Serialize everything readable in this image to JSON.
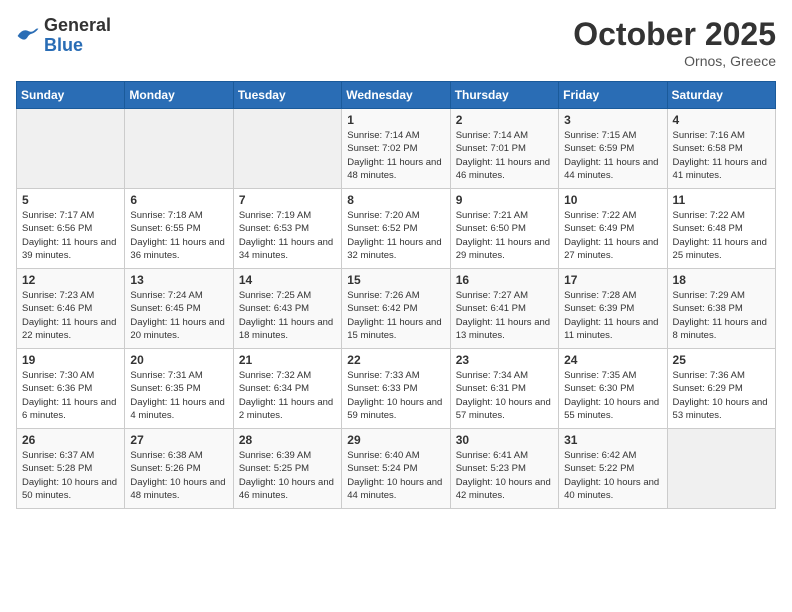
{
  "header": {
    "logo_general": "General",
    "logo_blue": "Blue",
    "month_title": "October 2025",
    "subtitle": "Ornos, Greece"
  },
  "days_of_week": [
    "Sunday",
    "Monday",
    "Tuesday",
    "Wednesday",
    "Thursday",
    "Friday",
    "Saturday"
  ],
  "weeks": [
    {
      "days": [
        {
          "number": "",
          "empty": true
        },
        {
          "number": "",
          "empty": true
        },
        {
          "number": "",
          "empty": true
        },
        {
          "number": "1",
          "sunrise": "7:14 AM",
          "sunset": "7:02 PM",
          "daylight": "11 hours and 48 minutes."
        },
        {
          "number": "2",
          "sunrise": "7:14 AM",
          "sunset": "7:01 PM",
          "daylight": "11 hours and 46 minutes."
        },
        {
          "number": "3",
          "sunrise": "7:15 AM",
          "sunset": "6:59 PM",
          "daylight": "11 hours and 44 minutes."
        },
        {
          "number": "4",
          "sunrise": "7:16 AM",
          "sunset": "6:58 PM",
          "daylight": "11 hours and 41 minutes."
        }
      ]
    },
    {
      "days": [
        {
          "number": "5",
          "sunrise": "7:17 AM",
          "sunset": "6:56 PM",
          "daylight": "11 hours and 39 minutes."
        },
        {
          "number": "6",
          "sunrise": "7:18 AM",
          "sunset": "6:55 PM",
          "daylight": "11 hours and 36 minutes."
        },
        {
          "number": "7",
          "sunrise": "7:19 AM",
          "sunset": "6:53 PM",
          "daylight": "11 hours and 34 minutes."
        },
        {
          "number": "8",
          "sunrise": "7:20 AM",
          "sunset": "6:52 PM",
          "daylight": "11 hours and 32 minutes."
        },
        {
          "number": "9",
          "sunrise": "7:21 AM",
          "sunset": "6:50 PM",
          "daylight": "11 hours and 29 minutes."
        },
        {
          "number": "10",
          "sunrise": "7:22 AM",
          "sunset": "6:49 PM",
          "daylight": "11 hours and 27 minutes."
        },
        {
          "number": "11",
          "sunrise": "7:22 AM",
          "sunset": "6:48 PM",
          "daylight": "11 hours and 25 minutes."
        }
      ]
    },
    {
      "days": [
        {
          "number": "12",
          "sunrise": "7:23 AM",
          "sunset": "6:46 PM",
          "daylight": "11 hours and 22 minutes."
        },
        {
          "number": "13",
          "sunrise": "7:24 AM",
          "sunset": "6:45 PM",
          "daylight": "11 hours and 20 minutes."
        },
        {
          "number": "14",
          "sunrise": "7:25 AM",
          "sunset": "6:43 PM",
          "daylight": "11 hours and 18 minutes."
        },
        {
          "number": "15",
          "sunrise": "7:26 AM",
          "sunset": "6:42 PM",
          "daylight": "11 hours and 15 minutes."
        },
        {
          "number": "16",
          "sunrise": "7:27 AM",
          "sunset": "6:41 PM",
          "daylight": "11 hours and 13 minutes."
        },
        {
          "number": "17",
          "sunrise": "7:28 AM",
          "sunset": "6:39 PM",
          "daylight": "11 hours and 11 minutes."
        },
        {
          "number": "18",
          "sunrise": "7:29 AM",
          "sunset": "6:38 PM",
          "daylight": "11 hours and 8 minutes."
        }
      ]
    },
    {
      "days": [
        {
          "number": "19",
          "sunrise": "7:30 AM",
          "sunset": "6:36 PM",
          "daylight": "11 hours and 6 minutes."
        },
        {
          "number": "20",
          "sunrise": "7:31 AM",
          "sunset": "6:35 PM",
          "daylight": "11 hours and 4 minutes."
        },
        {
          "number": "21",
          "sunrise": "7:32 AM",
          "sunset": "6:34 PM",
          "daylight": "11 hours and 2 minutes."
        },
        {
          "number": "22",
          "sunrise": "7:33 AM",
          "sunset": "6:33 PM",
          "daylight": "10 hours and 59 minutes."
        },
        {
          "number": "23",
          "sunrise": "7:34 AM",
          "sunset": "6:31 PM",
          "daylight": "10 hours and 57 minutes."
        },
        {
          "number": "24",
          "sunrise": "7:35 AM",
          "sunset": "6:30 PM",
          "daylight": "10 hours and 55 minutes."
        },
        {
          "number": "25",
          "sunrise": "7:36 AM",
          "sunset": "6:29 PM",
          "daylight": "10 hours and 53 minutes."
        }
      ]
    },
    {
      "days": [
        {
          "number": "26",
          "sunrise": "6:37 AM",
          "sunset": "5:28 PM",
          "daylight": "10 hours and 50 minutes."
        },
        {
          "number": "27",
          "sunrise": "6:38 AM",
          "sunset": "5:26 PM",
          "daylight": "10 hours and 48 minutes."
        },
        {
          "number": "28",
          "sunrise": "6:39 AM",
          "sunset": "5:25 PM",
          "daylight": "10 hours and 46 minutes."
        },
        {
          "number": "29",
          "sunrise": "6:40 AM",
          "sunset": "5:24 PM",
          "daylight": "10 hours and 44 minutes."
        },
        {
          "number": "30",
          "sunrise": "6:41 AM",
          "sunset": "5:23 PM",
          "daylight": "10 hours and 42 minutes."
        },
        {
          "number": "31",
          "sunrise": "6:42 AM",
          "sunset": "5:22 PM",
          "daylight": "10 hours and 40 minutes."
        },
        {
          "number": "",
          "empty": true
        }
      ]
    }
  ]
}
